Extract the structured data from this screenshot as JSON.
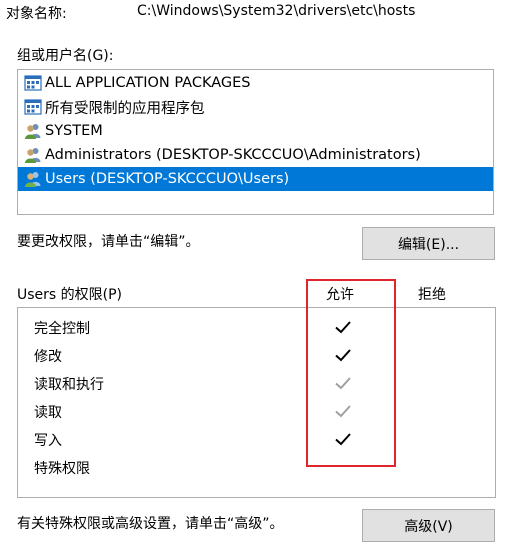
{
  "object": {
    "label": "对象名称:",
    "value": "C:\\Windows\\System32\\drivers\\etc\\hosts"
  },
  "groups": {
    "label": "组或用户名(G):",
    "items": [
      {
        "name": "ALL APPLICATION PACKAGES",
        "icon": "package-group-icon",
        "selected": false
      },
      {
        "name": "所有受限制的应用程序包",
        "icon": "package-group-icon",
        "selected": false
      },
      {
        "name": "SYSTEM",
        "icon": "users-icon",
        "selected": false
      },
      {
        "name": "Administrators (DESKTOP-SKCCCUO\\Administrators)",
        "icon": "users-icon",
        "selected": false
      },
      {
        "name": "Users (DESKTOP-SKCCCUO\\Users)",
        "icon": "users-icon",
        "selected": true
      }
    ]
  },
  "change_note": "要更改权限，请单击“编辑”。",
  "edit_button": "编辑(E)...",
  "permissions": {
    "header": "Users 的权限(P)",
    "allow_label": "允许",
    "deny_label": "拒绝",
    "rows": [
      {
        "name": "完全控制",
        "allow": "checked"
      },
      {
        "name": "修改",
        "allow": "checked"
      },
      {
        "name": "读取和执行",
        "allow": "checked-gray"
      },
      {
        "name": "读取",
        "allow": "checked-gray"
      },
      {
        "name": "写入",
        "allow": "checked"
      },
      {
        "name": "特殊权限",
        "allow": "none"
      }
    ]
  },
  "advanced_note": "有关特殊权限或高级设置，请单击“高级”。",
  "advanced_button": "高级(V)",
  "colors": {
    "selection": "#0078d7",
    "highlight_box": "#e0262d",
    "check_dark": "#000000",
    "check_gray": "#a0a0a0"
  }
}
